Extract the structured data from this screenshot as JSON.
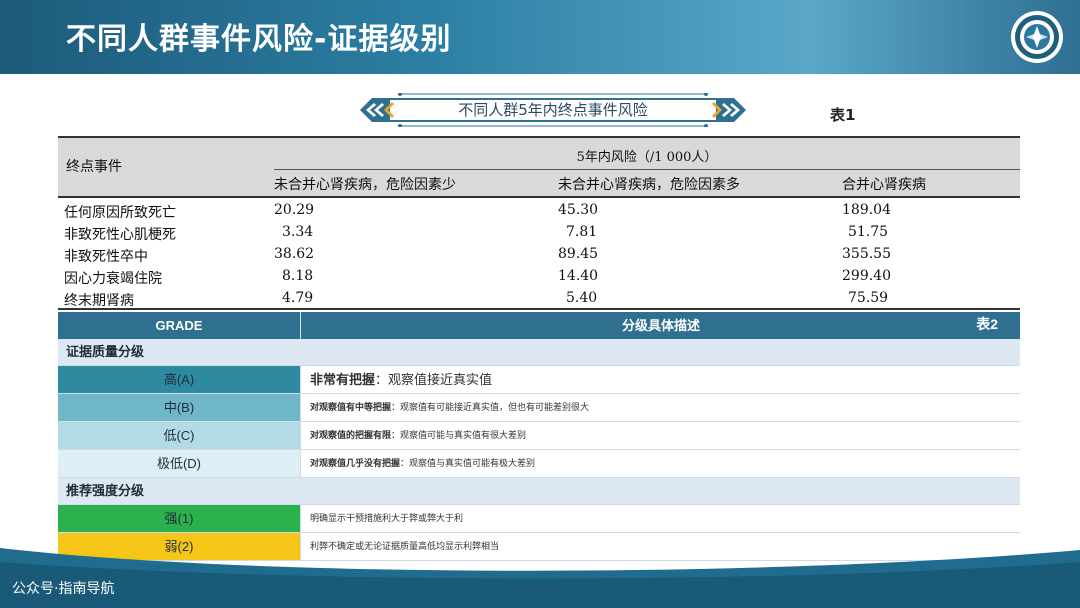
{
  "header": {
    "title": "不同人群事件风险-证据级别"
  },
  "banner": {
    "title": "不同人群5年内终点事件风险",
    "table_label": "表1"
  },
  "table1": {
    "row_header": "终点事件",
    "span_header": "5年内风险（/1 000人）",
    "columns": [
      "未合并心肾疾病，危险因素少",
      "未合并心肾疾病，危险因素多",
      "合并心肾疾病"
    ],
    "rows": [
      {
        "label": "任何原因所致死亡",
        "values": [
          "20.29",
          "45.30",
          "189.04"
        ]
      },
      {
        "label": "非致死性心肌梗死",
        "values": [
          "3.34",
          "7.81",
          "51.75"
        ]
      },
      {
        "label": "非致死性卒中",
        "values": [
          "38.62",
          "89.45",
          "355.55"
        ]
      },
      {
        "label": "因心力衰竭住院",
        "values": [
          "8.18",
          "14.40",
          "299.40"
        ]
      },
      {
        "label": "终末期肾病",
        "values": [
          "4.79",
          "5.40",
          "75.59"
        ]
      }
    ]
  },
  "table2": {
    "grade_header": "GRADE",
    "desc_header": "分级具体描述",
    "table_label": "表2",
    "quality_section": "证据质量分级",
    "quality_rows": [
      {
        "grade": "高(A)",
        "bold": "非常有把握",
        "text": "：观察值接近真实值",
        "color": "#2e8aa0"
      },
      {
        "grade": "中(B)",
        "bold": "对观察值有中等把握",
        "text": "：观察值有可能接近真实值，但也有可能差别很大",
        "color": "#6fb6c9"
      },
      {
        "grade": "低(C)",
        "bold": "对观察值的把握有限",
        "text": "：观察值可能与真实值有很大差别",
        "color": "#b3dbe5"
      },
      {
        "grade": "极低(D)",
        "bold": "对观察值几乎没有把握",
        "text": "：观察值与真实值可能有极大差别",
        "color": "#ddeef4"
      }
    ],
    "recommend_section": "推荐强度分级",
    "recommend_rows": [
      {
        "grade": "强(1)",
        "text": "明确显示干预措施利大于弊或弊大于利",
        "color": "#2bb24c"
      },
      {
        "grade": "弱(2)",
        "text": "利弊不确定或无论证据质量高低均显示利弊相当",
        "color": "#f5c518"
      }
    ]
  },
  "footer": {
    "text": "公众号·指南导航"
  }
}
